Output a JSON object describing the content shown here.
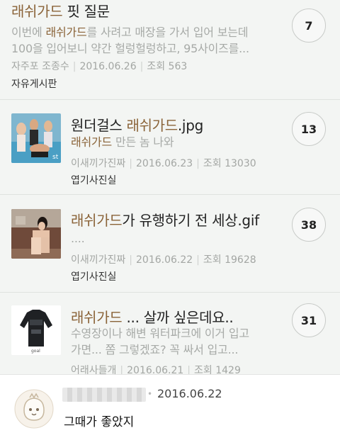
{
  "posts": [
    {
      "title_hl": "래쉬가드",
      "title_rest": " 핏 질문",
      "excerpt_line1_pre": "이번에 ",
      "excerpt_line1_hl": "래쉬가드",
      "excerpt_line1_post": "를 사려고 매장을 가서 입어 보는데",
      "excerpt_line2": "100을 입어보니 약간 헐렁헐렁하고, 95사이즈를...",
      "author": "자주포 조종수",
      "date": "2016.06.26",
      "views": "조회 563",
      "board": "자유게시판",
      "comments": "7"
    },
    {
      "title_rest": "원더걸스 ",
      "title_hl": "래쉬가드",
      "title_rest2": ".jpg",
      "excerpt_hl": "래쉬가드",
      "excerpt_post": " 만든 놈 나와",
      "author": "이새끼가진짜",
      "date": "2016.06.23",
      "views": "조회 13030",
      "board": "엽기사진실",
      "comments": "13"
    },
    {
      "title_hl": "래쉬가드",
      "title_rest": "가 유행하기 전 세상.gif",
      "excerpt": "....",
      "author": "이새끼가진짜",
      "date": "2016.06.22",
      "views": "조회 19628",
      "board": "엽기사진실",
      "comments": "38"
    },
    {
      "title_hl": "래쉬가드",
      "title_rest": " ... 살까 싶은데요..",
      "excerpt_line1": "수영장이나 해변 워터파크에 이거 입고",
      "excerpt_line2": "가면... 쫌 그렇겠죠? 꼭 싸서 입고...",
      "author": "어래사들개",
      "date": "2016.06.21",
      "views": "조회 1429",
      "comments": "31"
    }
  ],
  "comment": {
    "date": "2016.06.22",
    "text": "그때가 좋았지"
  },
  "colors": {
    "highlight": "#8a6338",
    "feed_bg": "#f3f5f3",
    "muted_text": "#a7aaa7"
  }
}
